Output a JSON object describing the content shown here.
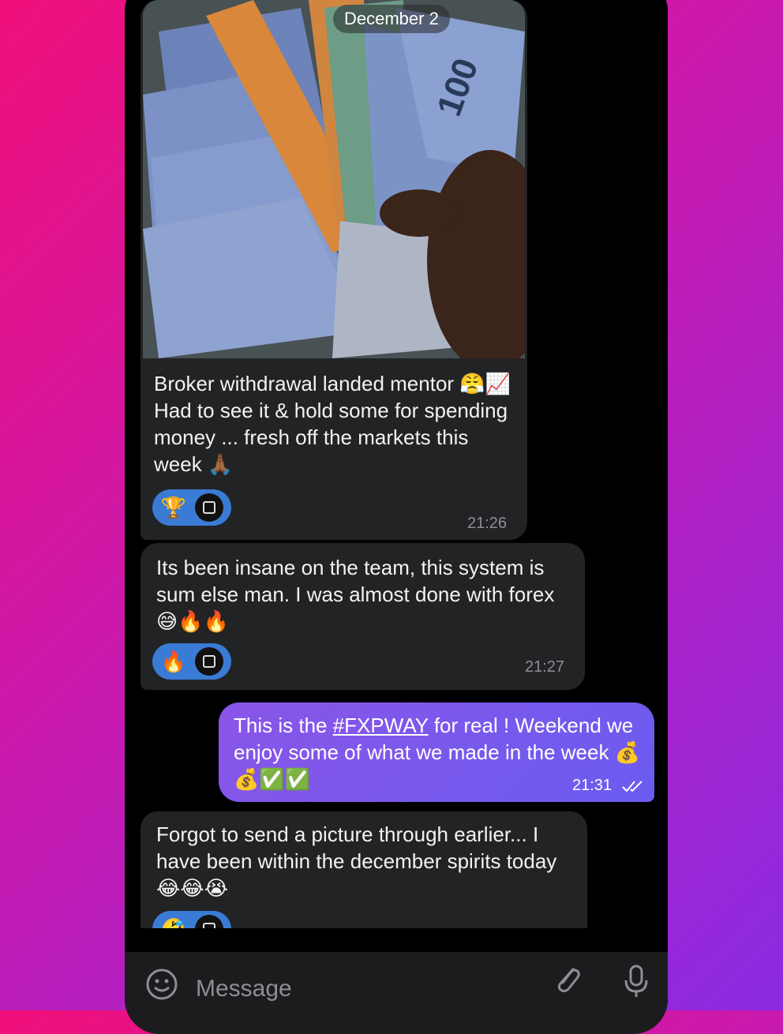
{
  "chat": {
    "date_label": "December 2",
    "messages": [
      {
        "text": "Broker withdrawal landed mentor 😤📈 Had to see it & hold some for spending money ... fresh off the markets this week 🙏🏾",
        "time": "21:26",
        "reaction_emoji": "🏆"
      },
      {
        "text": "Its been insane on the team, this system is sum else man. I was almost done with forex 😅🔥🔥",
        "time": "21:27",
        "reaction_emoji": "🔥"
      },
      {
        "text_prefix": "This is the ",
        "hashtag": "#FXPWAY",
        "text_suffix": " for real ! Weekend we enjoy some of what we made in the week 💰💰✅✅",
        "time": "21:31"
      },
      {
        "text": "Forgot to send a picture through earlier... I have been within the december spirits today 😂😂😭",
        "reaction_emoji": "🤣"
      }
    ]
  },
  "composer": {
    "placeholder": "Message",
    "icons": [
      "emoji-icon",
      "paperclip-icon",
      "microphone-icon"
    ]
  },
  "colors": {
    "incoming_bubble": "#222325",
    "outgoing_bubble": "#7b58ec",
    "reaction_pill": "#3a7bd5"
  }
}
